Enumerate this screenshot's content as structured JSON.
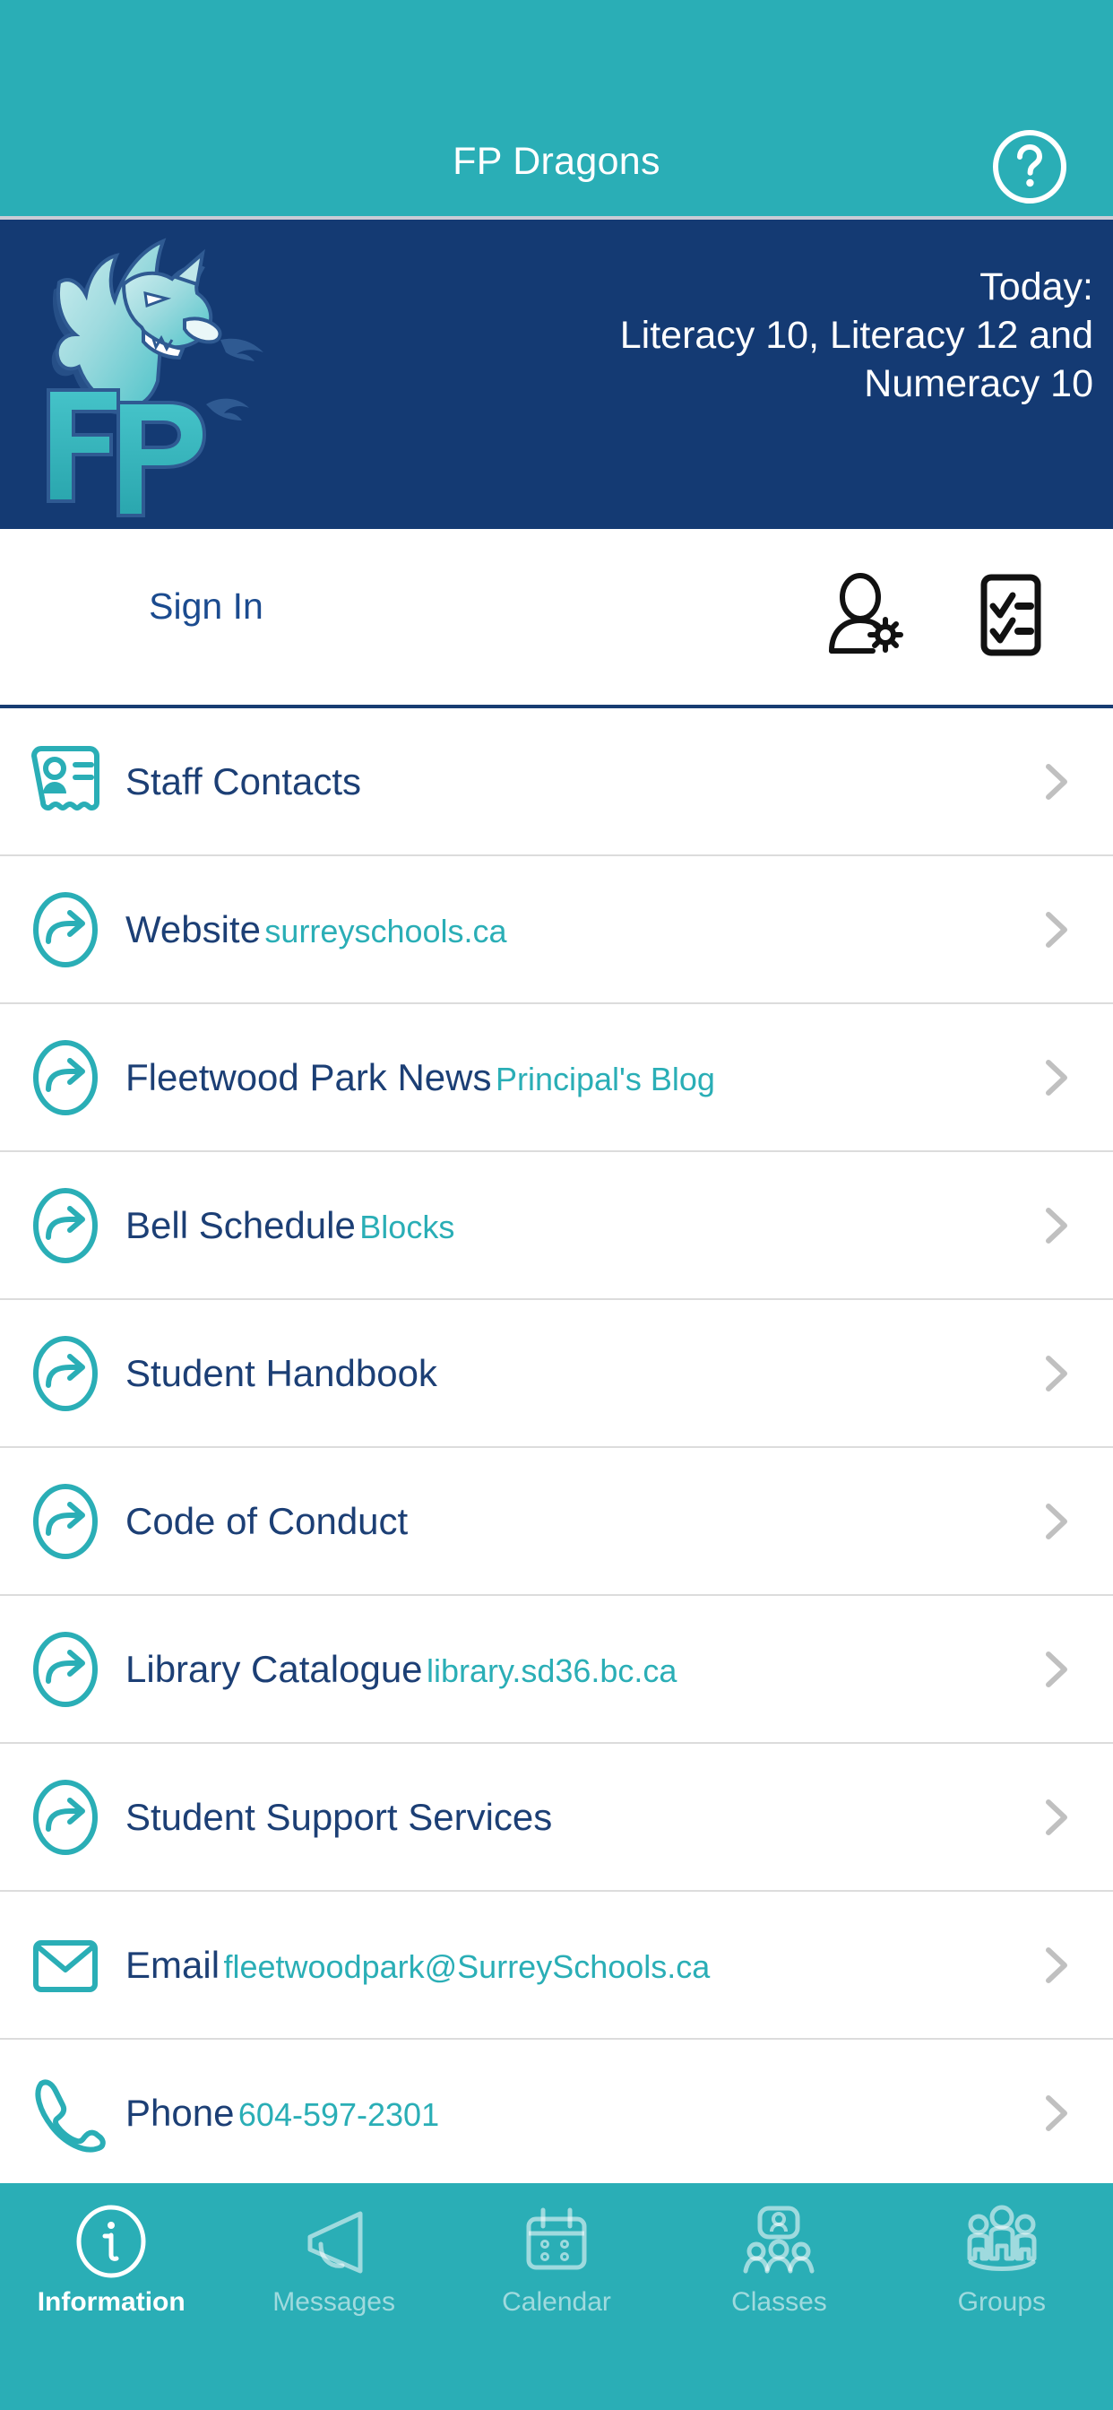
{
  "header": {
    "title": "FP Dragons",
    "help_icon": "help-circle-icon"
  },
  "banner": {
    "logo_text": "FP",
    "logo_alt": "dragon-logo",
    "today_label": "Today:",
    "today_line_1": "Literacy 10, Literacy 12 and",
    "today_line_2": "Numeracy 10"
  },
  "account_bar": {
    "sign_in_label": "Sign In",
    "user_settings_icon": "user-settings-icon",
    "checklist_icon": "checklist-icon"
  },
  "list": {
    "items": [
      {
        "title": "Staff Contacts",
        "subtitle": "",
        "icon": "contact-card-icon"
      },
      {
        "title": "Website",
        "subtitle": "surreyschools.ca",
        "icon": "external-link-icon"
      },
      {
        "title": "Fleetwood Park News",
        "subtitle": "Principal's Blog",
        "icon": "external-link-icon"
      },
      {
        "title": "Bell Schedule",
        "subtitle": "Blocks",
        "icon": "external-link-icon"
      },
      {
        "title": "Student Handbook",
        "subtitle": "",
        "icon": "external-link-icon"
      },
      {
        "title": "Code of Conduct",
        "subtitle": "",
        "icon": "external-link-icon"
      },
      {
        "title": "Library Catalogue",
        "subtitle": "library.sd36.bc.ca",
        "icon": "external-link-icon"
      },
      {
        "title": "Student Support Services",
        "subtitle": "",
        "icon": "external-link-icon"
      },
      {
        "title": "Email",
        "subtitle": "fleetwoodpark@SurreySchools.ca",
        "icon": "envelope-icon"
      },
      {
        "title": "Phone",
        "subtitle": "604-597-2301",
        "icon": "phone-icon"
      }
    ]
  },
  "tabbar": {
    "tabs": [
      {
        "label": "Information",
        "icon": "info-circle-icon",
        "active": true
      },
      {
        "label": "Messages",
        "icon": "megaphone-icon",
        "active": false
      },
      {
        "label": "Calendar",
        "icon": "calendar-icon",
        "active": false
      },
      {
        "label": "Classes",
        "icon": "classes-icon",
        "active": false
      },
      {
        "label": "Groups",
        "icon": "groups-icon",
        "active": false
      }
    ]
  },
  "colors": {
    "teal": "#2AAEB6",
    "navy": "#143A73",
    "title_blue": "#1c3f75",
    "subtitle_teal": "#2AAEB6",
    "chevron_gray": "#c0c0c0"
  }
}
